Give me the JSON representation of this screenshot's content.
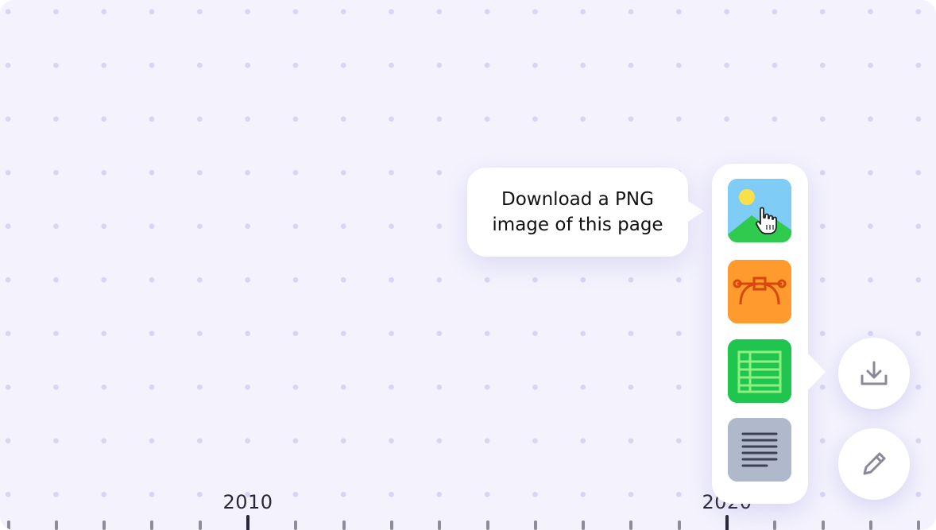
{
  "timeline": {
    "years": [
      {
        "label": "2010"
      },
      {
        "label": "2020"
      }
    ]
  },
  "tooltip": {
    "line1": "Download a PNG",
    "line2": "image of this page"
  },
  "export_menu": {
    "items": [
      {
        "name": "png-image-option",
        "icon": "image-landscape-icon",
        "color": "#7fcdf7"
      },
      {
        "name": "vector-svg-option",
        "icon": "bezier-curve-icon",
        "color": "#ff9a2e"
      },
      {
        "name": "spreadsheet-option",
        "icon": "spreadsheet-icon",
        "color": "#1fc54e"
      },
      {
        "name": "text-document-option",
        "icon": "text-lines-icon",
        "color": "#b0b8cc"
      }
    ]
  },
  "actions": {
    "download_icon": "download-icon",
    "edit_icon": "pencil-icon"
  },
  "colors": {
    "background": "#f3f2fd",
    "dot": "#d8d5f3",
    "text": "#2a2838"
  }
}
